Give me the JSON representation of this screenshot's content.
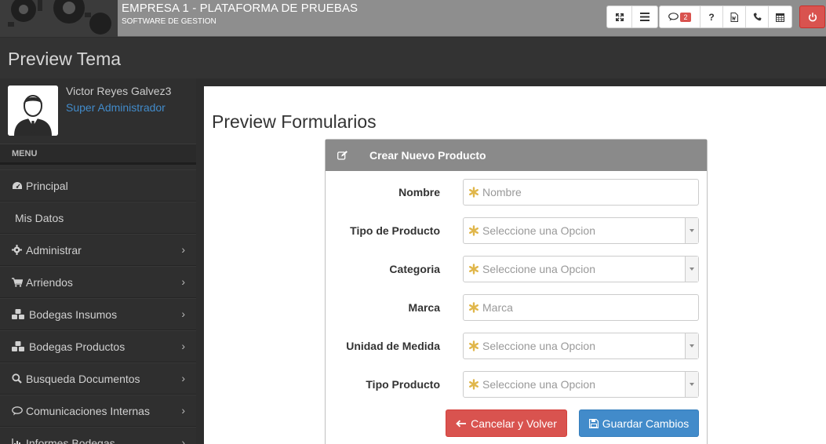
{
  "topbar": {
    "company": "EMPRESA 1 - PLATAFORMA DE PRUEBAS",
    "subtitle": "SOFTWARE DE GESTION",
    "messages_badge": "2",
    "help_label": "?",
    "icons": [
      "expand-icon",
      "list-icon",
      "comment-icon",
      "question-icon",
      "word-document-icon",
      "phone-icon",
      "calendar-icon",
      "power-icon"
    ]
  },
  "header": {
    "title": "Preview Tema"
  },
  "profile": {
    "name": "Victor Reyes Galvez3",
    "role": "Super Administrador"
  },
  "sidebar": {
    "menu_title": "MENU",
    "items": [
      {
        "label": "Principal",
        "icon": "dashboard-icon",
        "chevron": false
      },
      {
        "label": "Mis Datos",
        "icon": "",
        "chevron": false
      },
      {
        "label": "Administrar",
        "icon": "gear-icon",
        "chevron": true
      },
      {
        "label": "Arriendos",
        "icon": "cart-icon",
        "chevron": true
      },
      {
        "label": "Bodegas Insumos",
        "icon": "cubes-icon",
        "chevron": true
      },
      {
        "label": "Bodegas Productos",
        "icon": "cubes-icon",
        "chevron": true
      },
      {
        "label": "Busqueda Documentos",
        "icon": "search-icon",
        "chevron": true
      },
      {
        "label": "Comunicaciones Internas",
        "icon": "comment-icon",
        "chevron": true
      },
      {
        "label": "Informes Bodegas",
        "icon": "bar-chart-icon",
        "chevron": true
      }
    ]
  },
  "content": {
    "title": "Preview Formularios",
    "panel_title": "Crear Nuevo Producto",
    "fields": [
      {
        "label": "Nombre",
        "placeholder": "Nombre",
        "type": "text"
      },
      {
        "label": "Tipo de Producto",
        "placeholder": "Seleccione una Opcion",
        "type": "select"
      },
      {
        "label": "Categoria",
        "placeholder": "Seleccione una Opcion",
        "type": "select"
      },
      {
        "label": "Marca",
        "placeholder": "Marca",
        "type": "text"
      },
      {
        "label": "Unidad de Medida",
        "placeholder": "Seleccione una Opcion",
        "type": "select"
      },
      {
        "label": "Tipo Producto",
        "placeholder": "Seleccione una Opcion",
        "type": "select"
      }
    ],
    "cancel_label": "Cancelar y Volver",
    "save_label": "Guardar Cambios"
  },
  "colors": {
    "danger": "#d9534f",
    "primary": "#428bca",
    "role_link": "#428bca",
    "required_asterisk": "#e0b64a"
  }
}
